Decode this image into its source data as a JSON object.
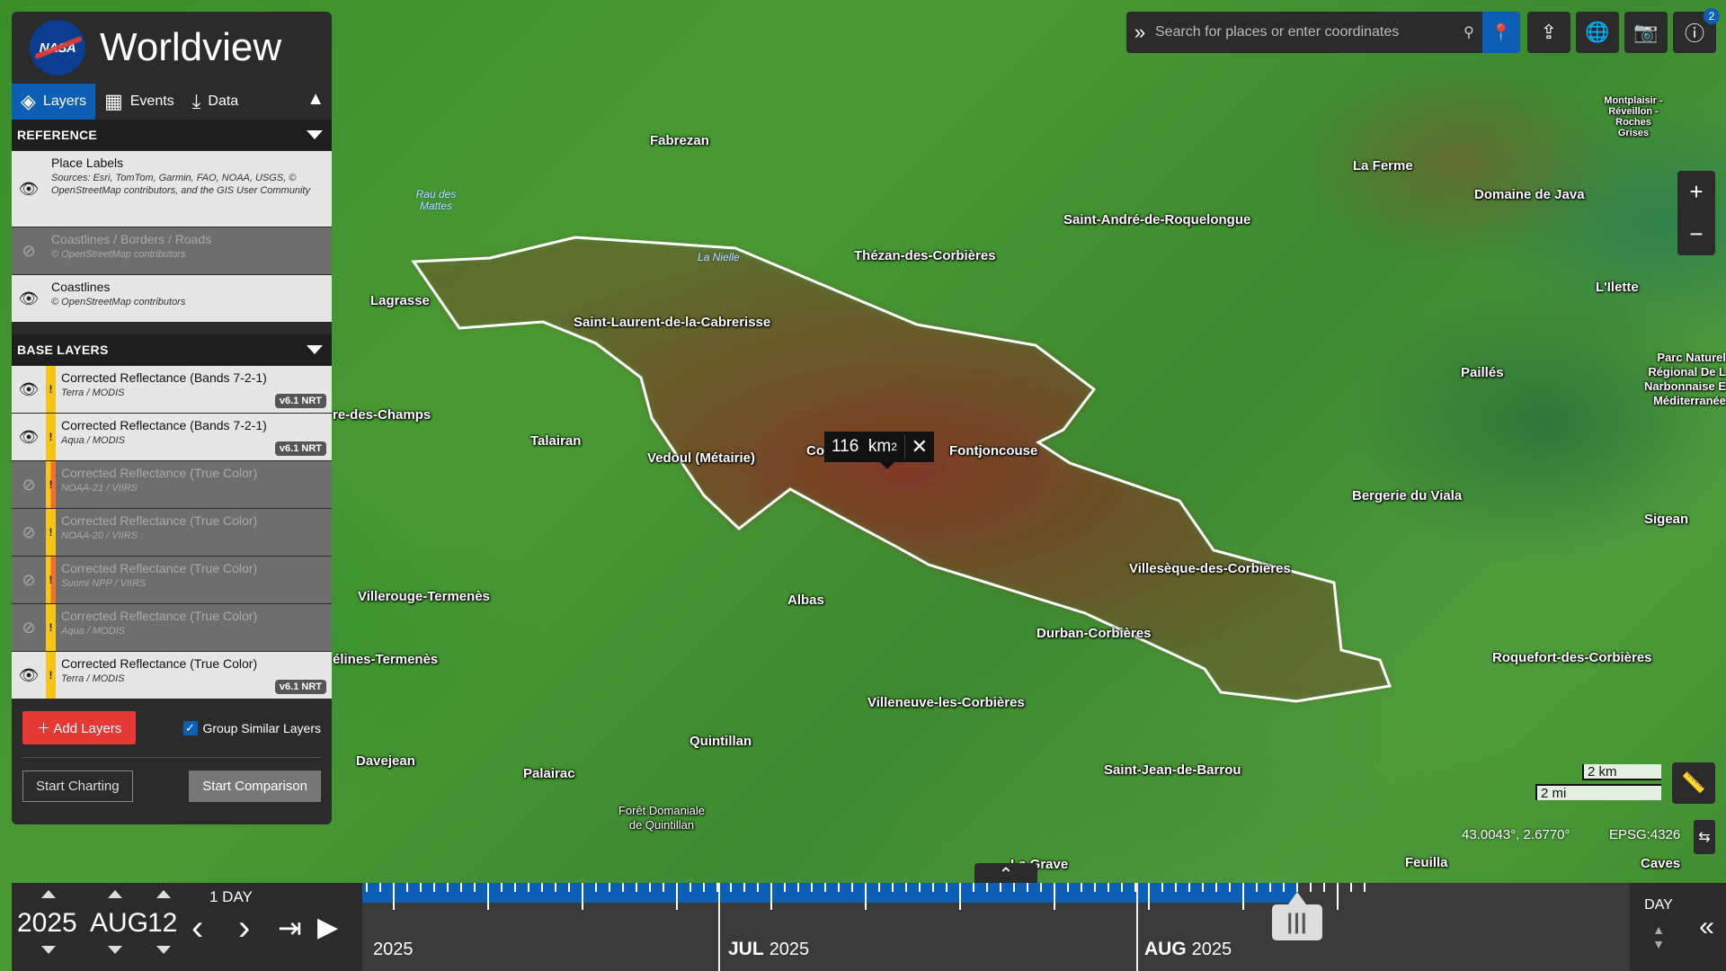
{
  "app": {
    "title": "Worldview",
    "logo_text": "NASA"
  },
  "tabs": [
    {
      "label": "Layers",
      "icon": "layers-icon"
    },
    {
      "label": "Events",
      "icon": "calendar-icon"
    },
    {
      "label": "Data",
      "icon": "download-icon"
    }
  ],
  "reference": {
    "header": "REFERENCE",
    "layers": [
      {
        "name": "Place Labels",
        "sub": "Sources: Esri, TomTom, Garmin, FAO, NOAA, USGS, © OpenStreetMap contributors, and the GIS User Community",
        "visible": true
      },
      {
        "name": "Coastlines / Borders / Roads",
        "sub": "© OpenStreetMap contributors",
        "visible": false
      },
      {
        "name": "Coastlines",
        "sub": "© OpenStreetMap contributors",
        "visible": true
      }
    ]
  },
  "base": {
    "header": "BASE LAYERS",
    "layers": [
      {
        "name": "Corrected Reflectance (Bands 7-2-1)",
        "sub": "Terra / MODIS",
        "badge": "v6.1 NRT",
        "visible": true
      },
      {
        "name": "Corrected Reflectance (Bands 7-2-1)",
        "sub": "Aqua / MODIS",
        "badge": "v6.1 NRT",
        "visible": true
      },
      {
        "name": "Corrected Reflectance (True Color)",
        "sub": "NOAA-21 / VIIRS",
        "visible": false
      },
      {
        "name": "Corrected Reflectance (True Color)",
        "sub": "NOAA-20 / VIIRS",
        "visible": false
      },
      {
        "name": "Corrected Reflectance (True Color)",
        "sub": "Suomi NPP / VIIRS",
        "visible": false
      },
      {
        "name": "Corrected Reflectance (True Color)",
        "sub": "Aqua / MODIS",
        "visible": false
      },
      {
        "name": "Corrected Reflectance (True Color)",
        "sub": "Terra / MODIS",
        "badge": "v6.1 NRT",
        "visible": true
      }
    ]
  },
  "footer": {
    "add_layers": "Add Layers",
    "group_similar": "Group Similar Layers",
    "start_charting": "Start Charting",
    "start_comparison": "Start Comparison"
  },
  "search": {
    "placeholder": "Search for places or enter coordinates"
  },
  "toolbar": {
    "info_count": "2"
  },
  "measure": {
    "value": "116",
    "unit": "km",
    "exp": "2"
  },
  "scale": {
    "km": "2 km",
    "mi": "2 mi"
  },
  "coords": {
    "latlon": "43.0043°, 2.6770°",
    "projection": "EPSG:4326"
  },
  "date": {
    "year": "2025",
    "month": "AUG",
    "day": "12",
    "interval": "1  DAY"
  },
  "timeline": {
    "months": [
      {
        "name": "",
        "year": "2025"
      },
      {
        "name": "JUL",
        "year": "2025"
      },
      {
        "name": "AUG",
        "year": "2025"
      }
    ],
    "zoom": "DAY"
  },
  "places": [
    {
      "text": "Fabrezan"
    },
    {
      "text": "La Ferme"
    },
    {
      "text": "Domaine de Java"
    },
    {
      "text": "Saint-André-de-Roquelongue"
    },
    {
      "text": "Thézan-des-Corbières"
    },
    {
      "text": "Lagrasse"
    },
    {
      "text": "Saint-Laurent-de-la-Cabrerisse"
    },
    {
      "text": "L'Ilette"
    },
    {
      "text": "Paillés"
    },
    {
      "text": "re-des-Champs"
    },
    {
      "text": "Talairan"
    },
    {
      "text": "Vedoul (Métairie)"
    },
    {
      "text": "Co"
    },
    {
      "text": "Fontjoncouse"
    },
    {
      "text": "Bergerie du Viala"
    },
    {
      "text": "Sigean"
    },
    {
      "text": "Villesèque-des-Corbières"
    },
    {
      "text": "Villerouge-Termenès"
    },
    {
      "text": "Albas"
    },
    {
      "text": "Durban-Corbières"
    },
    {
      "text": "élines-Termenès"
    },
    {
      "text": "Roquefort-des-Corbières"
    },
    {
      "text": "Villeneuve-les-Corbières"
    },
    {
      "text": "Quintillan"
    },
    {
      "text": "Davejean"
    },
    {
      "text": "Palairac"
    },
    {
      "text": "Saint-Jean-de-Barrou"
    },
    {
      "text": "Forêt Domaniale de Quintillan"
    },
    {
      "text": "La Grave"
    },
    {
      "text": "Feuilla"
    },
    {
      "text": "Caves"
    },
    {
      "text": "Rau des Mattes"
    },
    {
      "text": "La Nielle"
    },
    {
      "text": "Montplaisir - Réveillon - Roches Grises"
    },
    {
      "text": "Parc Naturel Régional De L Narbonnaise E Méditerranée"
    }
  ]
}
